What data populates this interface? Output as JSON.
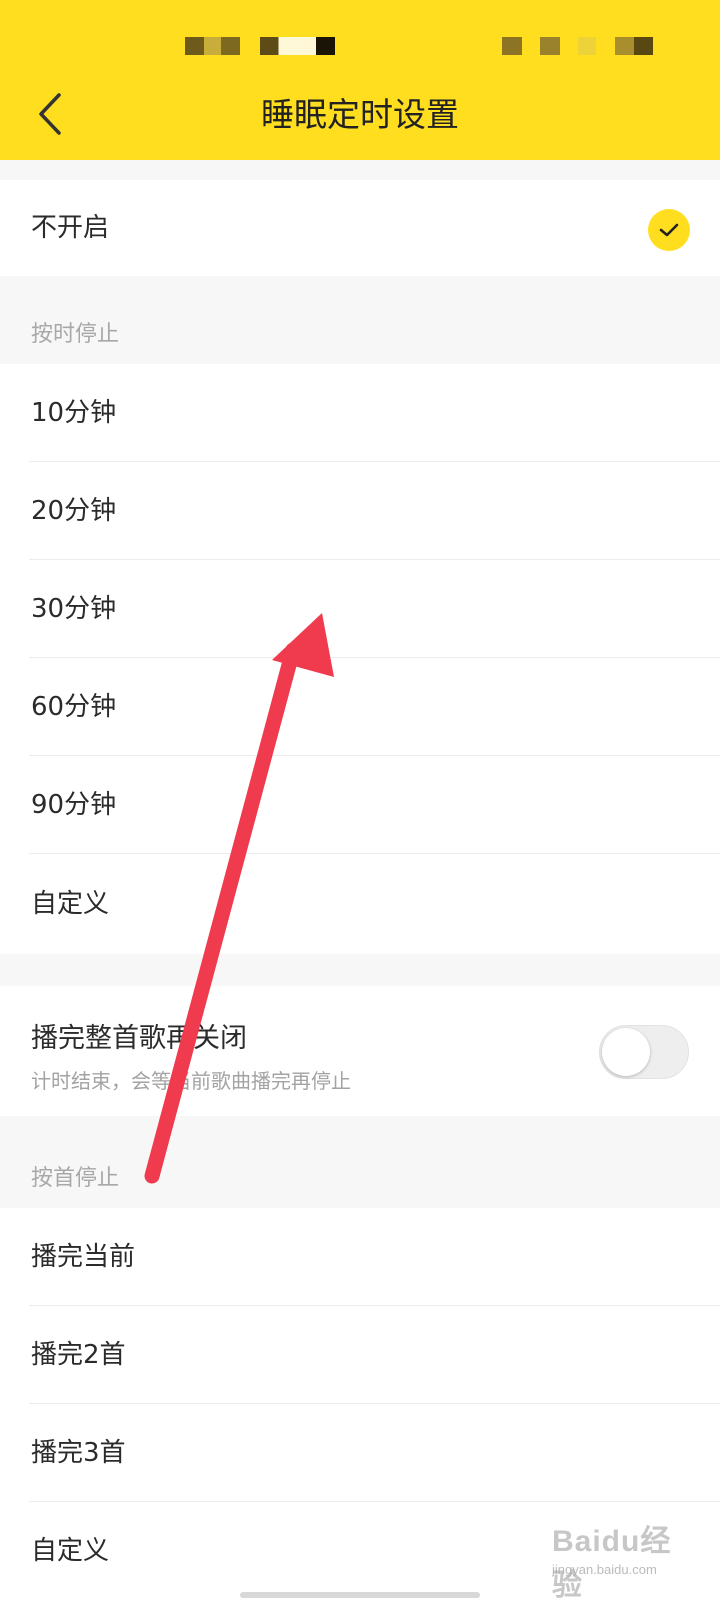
{
  "app": {
    "title": "睡眠定时设置",
    "accent_color": "#ffde1f",
    "back_icon": "chevron-left-icon"
  },
  "off_option": {
    "label": "不开启",
    "selected": true,
    "check_icon": "check-icon"
  },
  "by_time": {
    "header": "按时停止",
    "options": [
      {
        "label": "10分钟"
      },
      {
        "label": "20分钟"
      },
      {
        "label": "30分钟"
      },
      {
        "label": "60分钟"
      },
      {
        "label": "90分钟"
      },
      {
        "label": "自定义"
      }
    ]
  },
  "finish_song": {
    "title": "播完整首歌再关闭",
    "subtitle": "计时结束，会等当前歌曲播完再停止",
    "enabled": false
  },
  "by_song": {
    "header": "按首停止",
    "options": [
      {
        "label": "播完当前"
      },
      {
        "label": "播完2首"
      },
      {
        "label": "播完3首"
      },
      {
        "label": "自定义"
      }
    ]
  },
  "watermark": {
    "brand": "Baidu经验",
    "site": "jingyan.baidu.com"
  }
}
